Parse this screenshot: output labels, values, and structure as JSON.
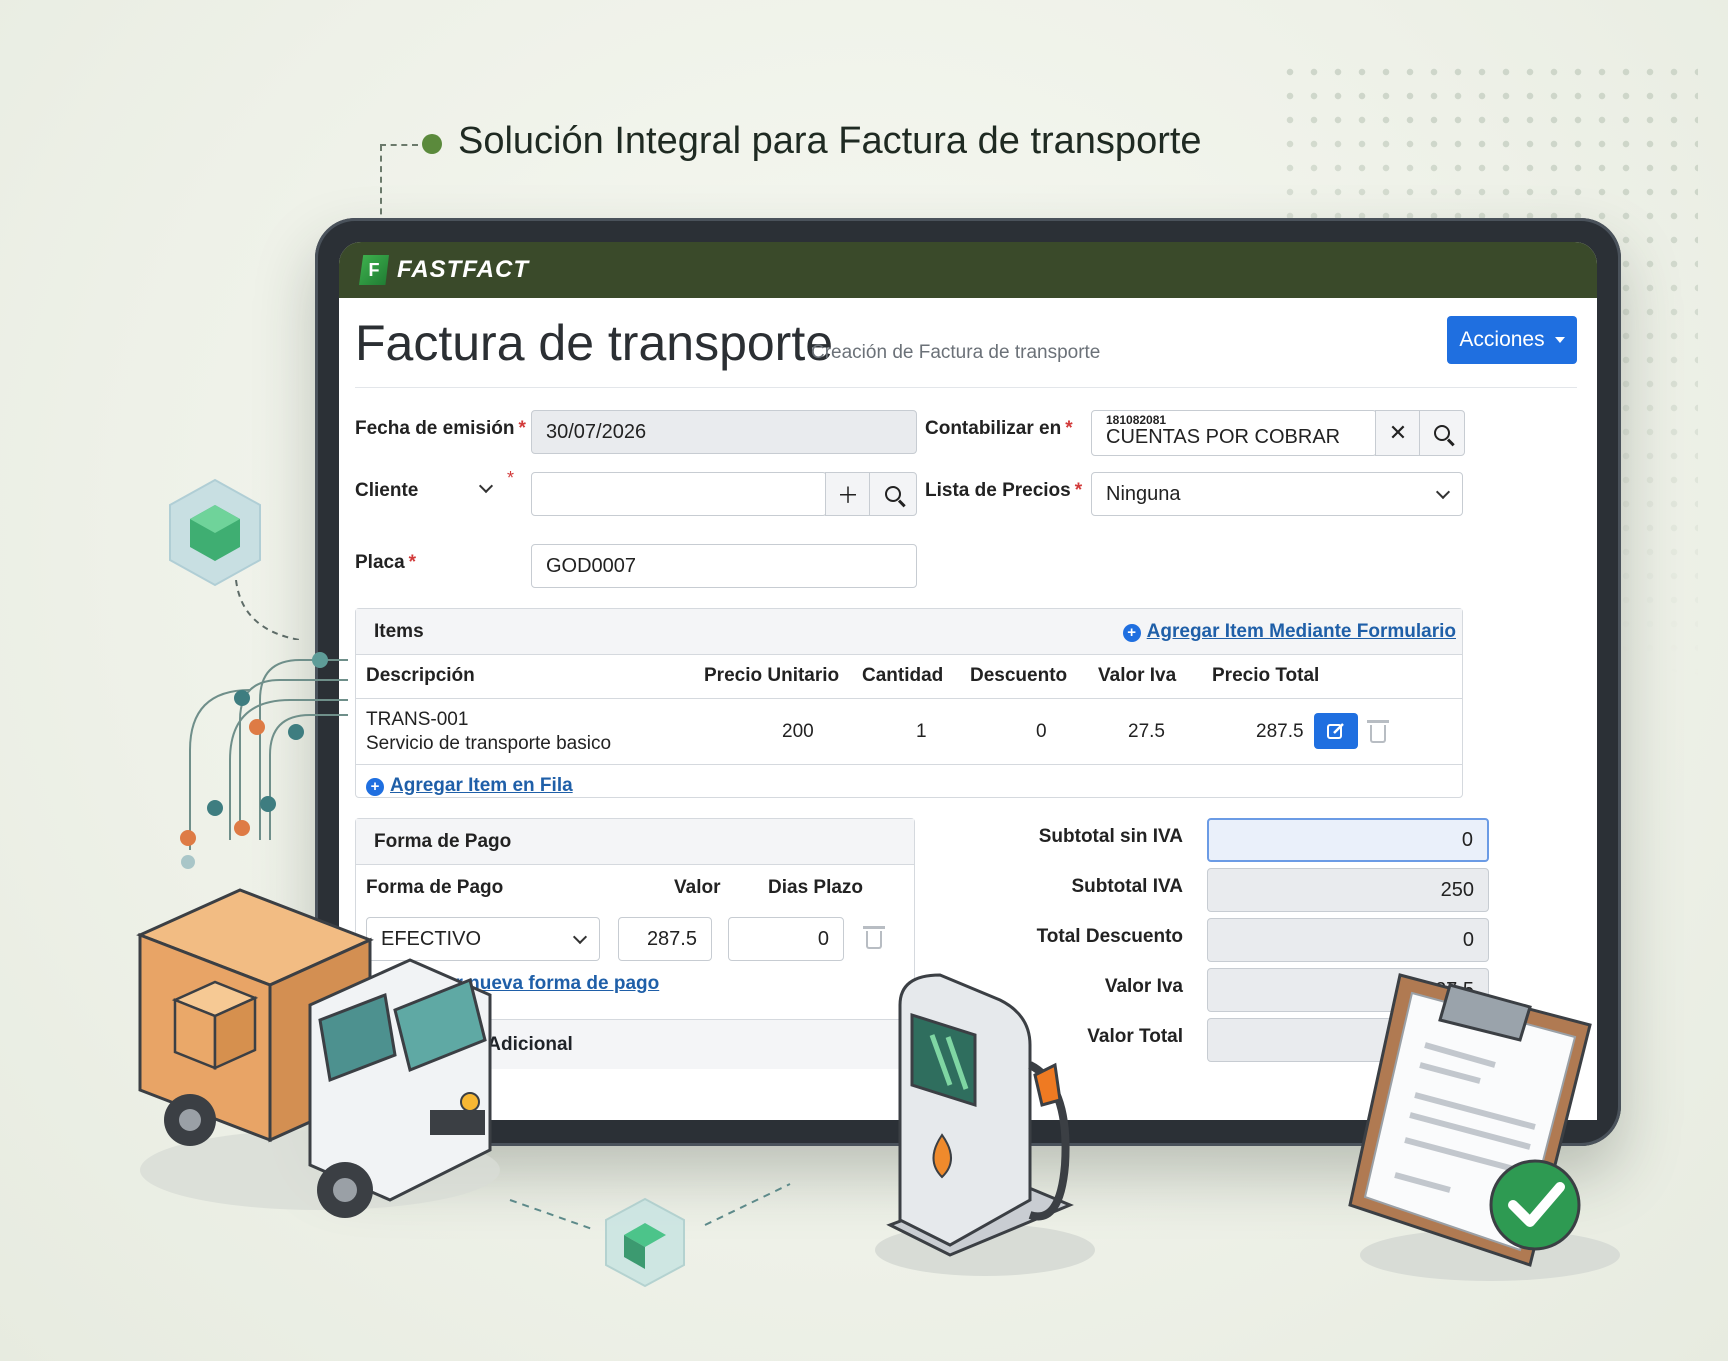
{
  "headline": "Solución Integral para Factura de transporte",
  "app": {
    "logo_letter": "F",
    "logo_text": "FASTFACT"
  },
  "header": {
    "title": "Factura de transporte",
    "subtitle": "Creación de Factura de transporte",
    "actions_label": "Acciones"
  },
  "form": {
    "fecha_label": "Fecha de emisión",
    "fecha_value": "30/07/2026",
    "contabilizar_label": "Contabilizar en",
    "contabilizar_code": "181082081",
    "contabilizar_value": "CUENTAS POR COBRAR",
    "cliente_label": "Cliente",
    "cliente_value": "",
    "lista_label": "Lista de Precios",
    "lista_value": "Ninguna",
    "placa_label": "Placa",
    "placa_value": "GOD0007",
    "required_mark": "*"
  },
  "items": {
    "title": "Items",
    "add_form_link": "Agregar Item Mediante Formulario",
    "columns": [
      "Descripción",
      "Precio Unitario",
      "Cantidad",
      "Descuento",
      "Valor Iva",
      "Precio Total"
    ],
    "rows": [
      {
        "code": "TRANS-001",
        "description": "Servicio de transporte basico",
        "precio": "200",
        "cantidad": "1",
        "descuento": "0",
        "iva": "27.5",
        "total": "287.5"
      }
    ],
    "add_row_link": "Agregar Item en Fila"
  },
  "payment": {
    "title": "Forma de Pago",
    "columns": [
      "Forma de Pago",
      "Valor",
      "Dias Plazo"
    ],
    "method": "EFECTIVO",
    "valor": "287.5",
    "dias": "0",
    "add_link": "Agregar nueva forma de pago",
    "additional": "Información Adicional"
  },
  "totals": [
    {
      "label": "Subtotal sin IVA",
      "value": "0"
    },
    {
      "label": "Subtotal IVA",
      "value": "250"
    },
    {
      "label": "Total Descuento",
      "value": "0"
    },
    {
      "label": "Valor Iva",
      "value": "27.5"
    },
    {
      "label": "Valor Total",
      "value": ""
    }
  ],
  "colors": {
    "appbar": "#3a4a2a",
    "primary": "#1f6fe0",
    "link": "#1f5fa8",
    "accent_green": "#5b8a3c"
  }
}
